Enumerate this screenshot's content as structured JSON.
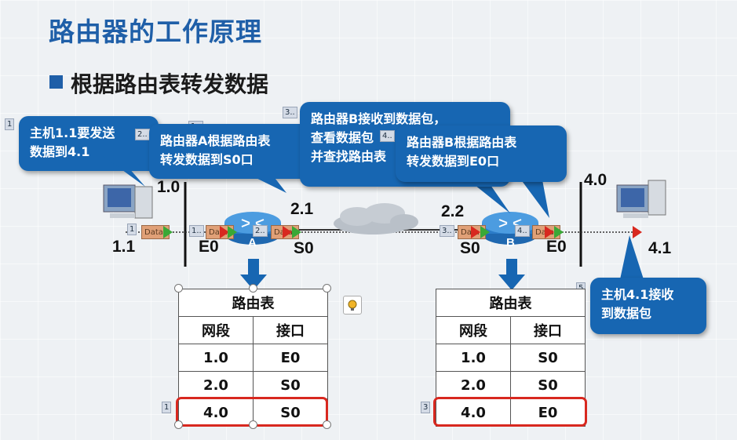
{
  "title": "路由器的工作原理",
  "subtitle": "根据路由表转发数据",
  "network": {
    "net_left": "1.0",
    "net_right": "4.0",
    "link_left": "2.1",
    "link_right": "2.2",
    "host_left": "1.1",
    "host_right": "4.1",
    "router_a": "A",
    "router_b": "B",
    "a_e0": "E0",
    "a_s0": "S0",
    "b_s0": "S0",
    "b_e0": "E0",
    "packet_label": "Data"
  },
  "callouts": {
    "c1": {
      "step": "1",
      "line1": "主机1.1要发送",
      "line2": "数据到4.1"
    },
    "c2": {
      "step": "2..",
      "line1": "路由器A根据路由表",
      "line2": "转发数据到S0口"
    },
    "c3": {
      "step": "3..",
      "line1": "路由器B接收到数据包，",
      "line2": "查看数据包",
      "line3": "并查找路由表"
    },
    "c4": {
      "step": "4..",
      "line1": "路由器B根据路由表",
      "line2": "转发数据到E0口"
    },
    "c5": {
      "step": "5",
      "line1": "主机4.1接收",
      "line2": "到数据包"
    }
  },
  "step_tags": {
    "t1": "1..",
    "t_pkt1": "1",
    "t_pkt2": "1..",
    "t_pkt3": "2..",
    "t_pkt4": "3..",
    "t_pkt5": "4..",
    "t_tbl_a": "1",
    "t_tbl_b": "3"
  },
  "table_a": {
    "caption": "路由表",
    "headers": [
      "网段",
      "接口"
    ],
    "rows": [
      [
        "1.0",
        "E0"
      ],
      [
        "2.0",
        "S0"
      ],
      [
        "4.0",
        "S0"
      ]
    ]
  },
  "table_b": {
    "caption": "路由表",
    "headers": [
      "网段",
      "接口"
    ],
    "rows": [
      [
        "1.0",
        "S0"
      ],
      [
        "2.0",
        "S0"
      ],
      [
        "4.0",
        "E0"
      ]
    ]
  },
  "colors": {
    "accent": "#1766b2",
    "title": "#1f5fa8",
    "highlight": "#d8281f"
  }
}
